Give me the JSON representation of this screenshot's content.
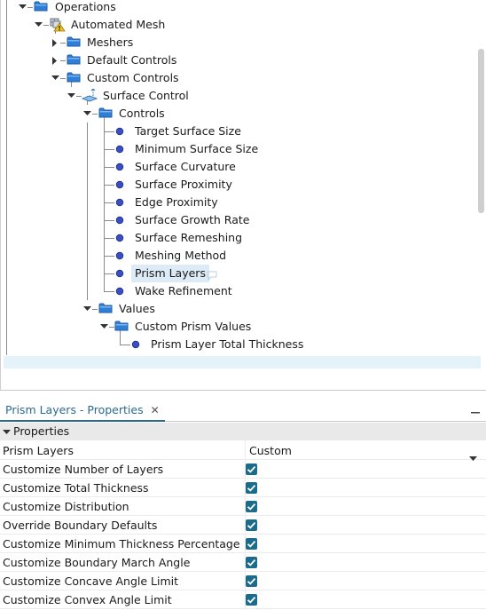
{
  "tree": {
    "nodes": {
      "operations": "Operations",
      "automated_mesh": "Automated Mesh",
      "meshers": "Meshers",
      "default_controls": "Default Controls",
      "custom_controls": "Custom Controls",
      "surface_control": "Surface Control",
      "controls": "Controls",
      "target_surface_size": "Target Surface Size",
      "minimum_surface_size": "Minimum Surface Size",
      "surface_curvature": "Surface Curvature",
      "surface_proximity": "Surface Proximity",
      "edge_proximity": "Edge Proximity",
      "surface_growth_rate": "Surface Growth Rate",
      "surface_remeshing": "Surface Remeshing",
      "meshing_method": "Meshing Method",
      "prism_layers": "Prism Layers",
      "wake_refinement": "Wake Refinement",
      "values": "Values",
      "custom_prism_values": "Custom Prism Values",
      "prism_layer_total_thickness": "Prism Layer Total Thickness"
    },
    "selected": "Prism Layers"
  },
  "properties_panel": {
    "tab_title": "Prism Layers - Properties",
    "tab_close": "✕",
    "section_header": "Properties",
    "rows": [
      {
        "name": "Prism Layers",
        "value": "Custom",
        "kind": "dropdown"
      },
      {
        "name": "Customize Number of Layers",
        "checked": true,
        "kind": "checkbox"
      },
      {
        "name": "Customize Total Thickness",
        "checked": true,
        "kind": "checkbox"
      },
      {
        "name": "Customize Distribution",
        "checked": true,
        "kind": "checkbox"
      },
      {
        "name": "Override Boundary Defaults",
        "checked": true,
        "kind": "checkbox"
      },
      {
        "name": "Customize Minimum Thickness Percentage",
        "checked": true,
        "kind": "checkbox"
      },
      {
        "name": "Customize Boundary March Angle",
        "checked": true,
        "kind": "checkbox"
      },
      {
        "name": "Customize Concave Angle Limit",
        "checked": true,
        "kind": "checkbox"
      },
      {
        "name": "Customize Convex Angle Limit",
        "checked": true,
        "kind": "checkbox"
      }
    ]
  },
  "colors": {
    "accent": "#2a6a8f",
    "checkbox": "#1b6c8c",
    "selection": "#dcebf5",
    "folder": "#2f7fd6",
    "leaf_dot": "#3a4fc4"
  }
}
